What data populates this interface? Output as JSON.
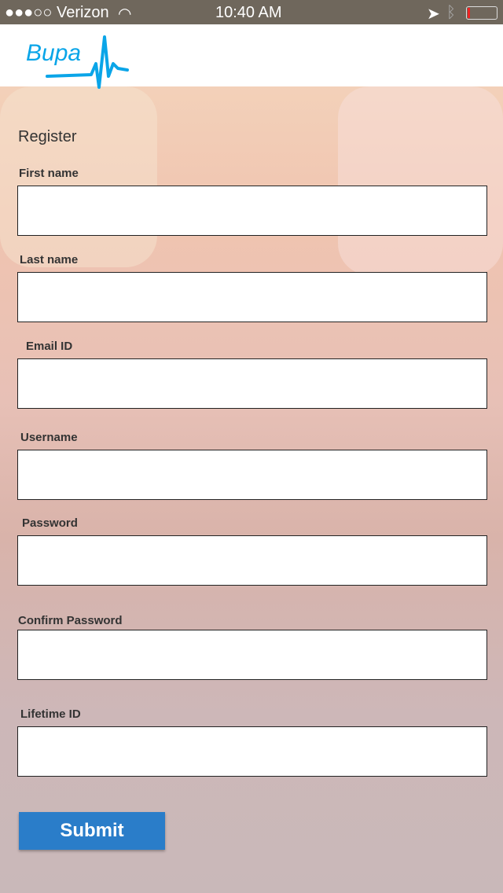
{
  "status_bar": {
    "carrier": "●●●○○ Verizon",
    "time": "10:40 AM"
  },
  "header": {
    "logo_text": "Bupa",
    "brand_color": "#0aa5e8"
  },
  "form": {
    "title": "Register",
    "fields": [
      {
        "label": "First name",
        "value": ""
      },
      {
        "label": "Last name",
        "value": ""
      },
      {
        "label": "Email ID",
        "value": ""
      },
      {
        "label": "Username",
        "value": ""
      },
      {
        "label": "Password",
        "value": ""
      },
      {
        "label": "Confirm Password",
        "value": ""
      },
      {
        "label": "Lifetime ID",
        "value": ""
      }
    ],
    "submit_label": "Submit",
    "button_color": "#2a7dc9"
  }
}
